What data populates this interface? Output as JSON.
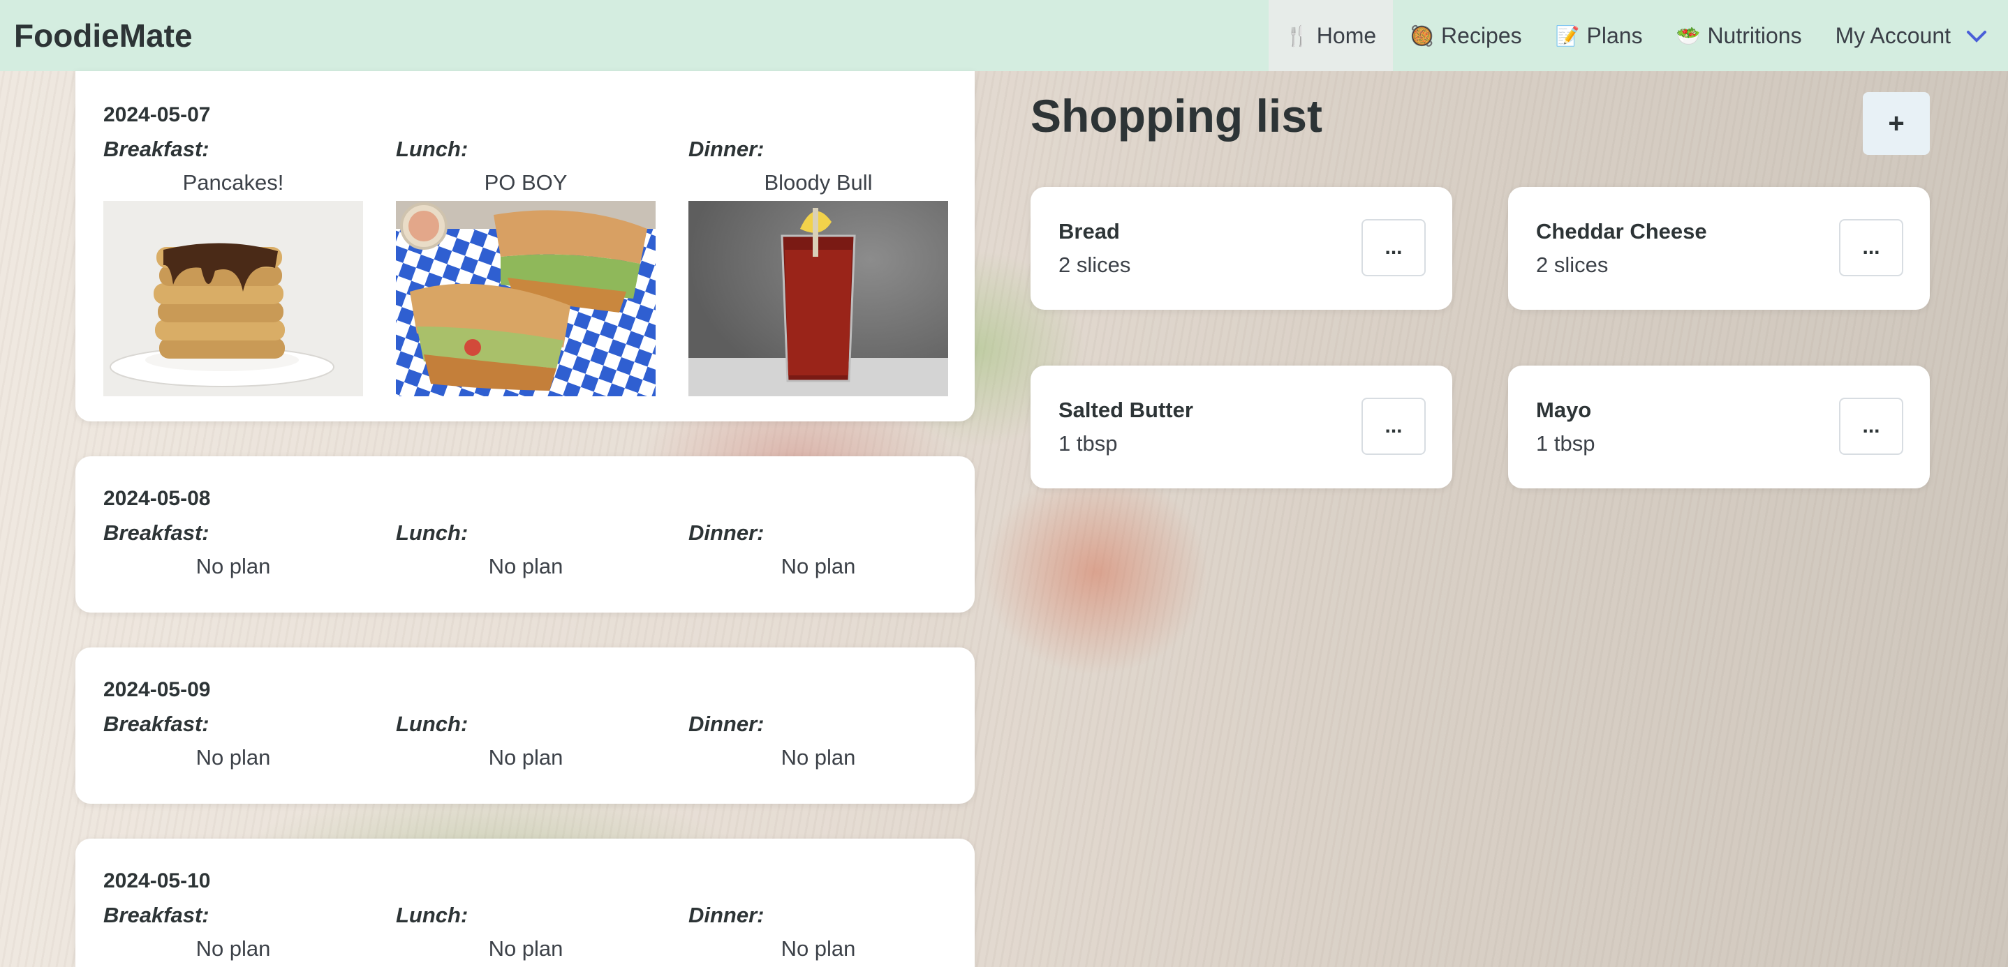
{
  "brand": "FoodieMate",
  "nav": [
    {
      "icon": "🍴",
      "label": "Home"
    },
    {
      "icon": "🥘",
      "label": "Recipes"
    },
    {
      "icon": "📝",
      "label": "Plans"
    },
    {
      "icon": "🥗",
      "label": "Nutritions"
    },
    {
      "icon": "",
      "label": "My Account"
    }
  ],
  "days": [
    {
      "date": "2024-05-07",
      "breakfast_label": "Breakfast:",
      "lunch_label": "Lunch:",
      "dinner_label": "Dinner:",
      "breakfast": "Pancakes!",
      "lunch": "PO BOY",
      "dinner": "Bloody Bull"
    },
    {
      "date": "2024-05-08",
      "breakfast_label": "Breakfast:",
      "lunch_label": "Lunch:",
      "dinner_label": "Dinner:",
      "breakfast": "No plan",
      "lunch": "No plan",
      "dinner": "No plan"
    },
    {
      "date": "2024-05-09",
      "breakfast_label": "Breakfast:",
      "lunch_label": "Lunch:",
      "dinner_label": "Dinner:",
      "breakfast": "No plan",
      "lunch": "No plan",
      "dinner": "No plan"
    },
    {
      "date": "2024-05-10",
      "breakfast_label": "Breakfast:",
      "lunch_label": "Lunch:",
      "dinner_label": "Dinner:",
      "breakfast": "No plan",
      "lunch": "No plan",
      "dinner": "No plan"
    }
  ],
  "shopping": {
    "title": "Shopping list",
    "add_label": "+",
    "more_label": "...",
    "items": [
      {
        "name": "Bread",
        "qty": "2 slices"
      },
      {
        "name": "Cheddar Cheese",
        "qty": "2 slices"
      },
      {
        "name": "Salted Butter",
        "qty": "1 tbsp"
      },
      {
        "name": "Mayo",
        "qty": "1 tbsp"
      }
    ]
  }
}
